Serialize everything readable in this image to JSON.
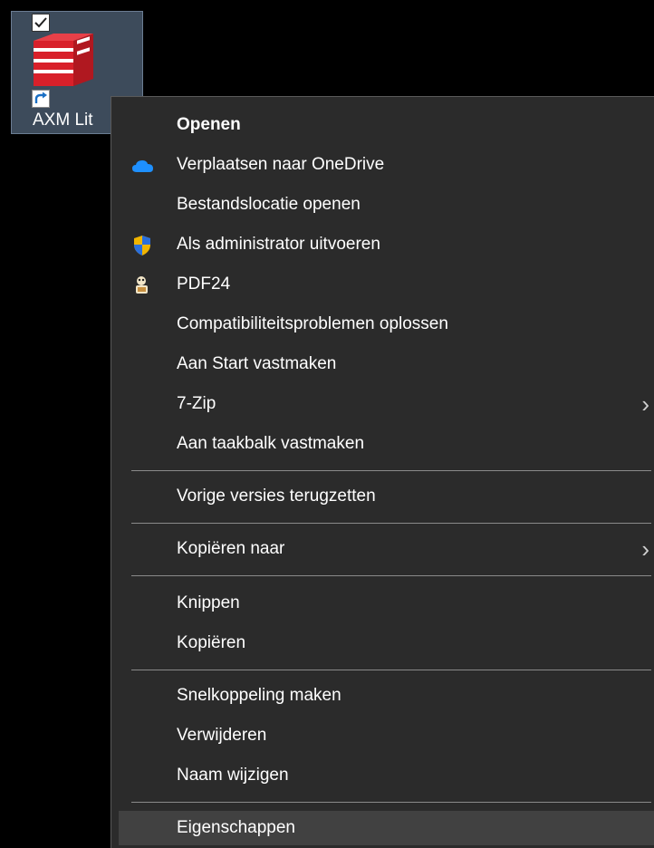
{
  "desktop": {
    "icon_label": "AXM Lit",
    "background_color": "#000000",
    "selection_color": "#3d4b5b",
    "checked": true
  },
  "menu": {
    "background_color": "#2b2b2b",
    "highlight_color": "#414141",
    "items": [
      {
        "label": "Openen",
        "bold": true,
        "icon": ""
      },
      {
        "label": "Verplaatsen naar OneDrive",
        "icon": "onedrive-cloud-icon"
      },
      {
        "label": "Bestandslocatie openen",
        "icon": ""
      },
      {
        "label": "Als administrator uitvoeren",
        "icon": "uac-shield-icon"
      },
      {
        "label": "PDF24",
        "icon": "pdf24-icon"
      },
      {
        "label": "Compatibiliteitsproblemen oplossen",
        "icon": ""
      },
      {
        "label": "Aan Start vastmaken",
        "icon": ""
      },
      {
        "label": "7-Zip",
        "icon": "",
        "submenu": true,
        "chevron": "›"
      },
      {
        "label": "Aan taakbalk vastmaken",
        "icon": ""
      },
      {
        "label": "Vorige versies terugzetten",
        "icon": ""
      },
      {
        "label": "Kopiëren naar",
        "icon": "",
        "submenu": true,
        "chevron": "›"
      },
      {
        "label": "Knippen",
        "icon": ""
      },
      {
        "label": "Kopiëren",
        "icon": ""
      },
      {
        "label": "Snelkoppeling maken",
        "icon": ""
      },
      {
        "label": "Verwijderen",
        "icon": ""
      },
      {
        "label": "Naam wijzigen",
        "icon": ""
      },
      {
        "label": "Eigenschappen",
        "icon": "",
        "hovered": true
      }
    ]
  }
}
